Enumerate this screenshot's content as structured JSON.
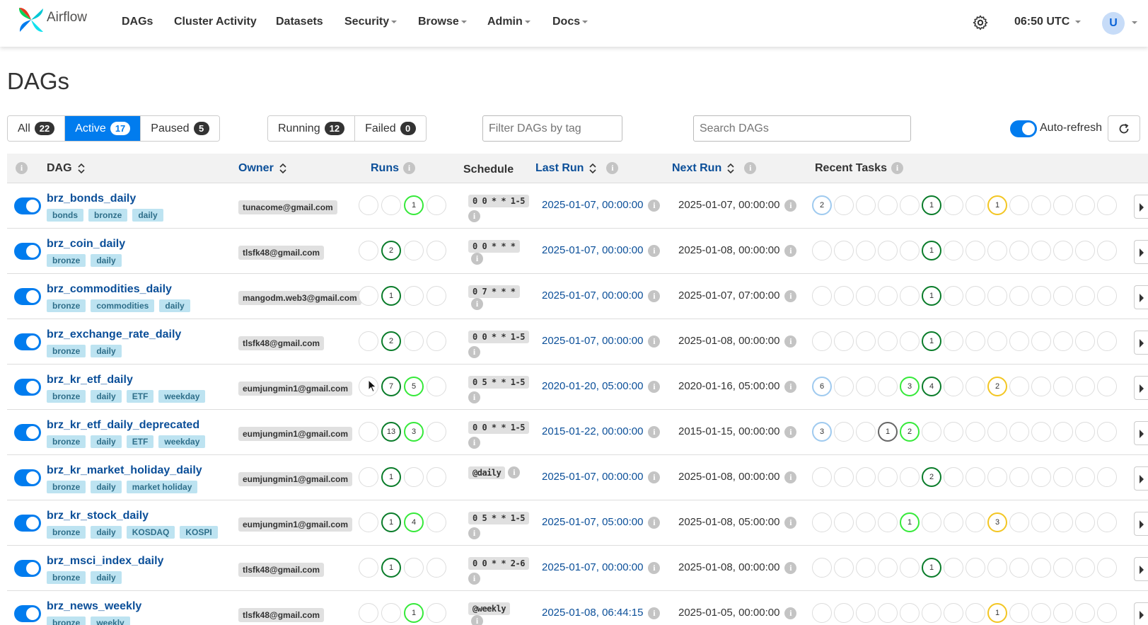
{
  "brand": {
    "name": "Airflow"
  },
  "nav": {
    "items": [
      {
        "label": "DAGs",
        "dropdown": false
      },
      {
        "label": "Cluster Activity",
        "dropdown": false
      },
      {
        "label": "Datasets",
        "dropdown": false
      },
      {
        "label": "Security",
        "dropdown": true
      },
      {
        "label": "Browse",
        "dropdown": true
      },
      {
        "label": "Admin",
        "dropdown": true
      },
      {
        "label": "Docs",
        "dropdown": true
      }
    ],
    "time": "06:50 UTC",
    "avatar_initial": "U"
  },
  "page": {
    "title": "DAGs"
  },
  "filters": {
    "status": [
      {
        "label": "All",
        "count": "22",
        "active": false
      },
      {
        "label": "Active",
        "count": "17",
        "active": true
      },
      {
        "label": "Paused",
        "count": "5",
        "active": false
      }
    ],
    "runs": [
      {
        "label": "Running",
        "count": "12"
      },
      {
        "label": "Failed",
        "count": "0"
      }
    ],
    "tag_placeholder": "Filter DAGs by tag",
    "search_placeholder": "Search DAGs",
    "autorefresh_label": "Auto-refresh"
  },
  "table": {
    "headers": {
      "dag": "DAG",
      "owner": "Owner",
      "runs": "Runs",
      "schedule": "Schedule",
      "last_run": "Last Run",
      "next_run": "Next Run",
      "recent_tasks": "Recent Tasks"
    },
    "rows": [
      {
        "name": "brz_bonds_daily",
        "tags": [
          "bonds",
          "bronze",
          "daily"
        ],
        "owner": "tunacome@gmail.com",
        "runs": [
          [
            "",
            ""
          ],
          [
            "",
            ""
          ],
          [
            "1",
            "lg"
          ],
          [
            "",
            ""
          ]
        ],
        "schedule": "0 0 * * 1-5",
        "sched_info_below": true,
        "last_run": "2025-01-07, 00:00:00",
        "next_run": "2025-01-07, 00:00:00",
        "tasks": {
          "0": [
            "2",
            "blue"
          ],
          "5": [
            "1",
            "dg"
          ],
          "8": [
            "1",
            "yel"
          ]
        }
      },
      {
        "name": "brz_coin_daily",
        "tags": [
          "bronze",
          "daily"
        ],
        "owner": "tlsfk48@gmail.com",
        "runs": [
          [
            "",
            ""
          ],
          [
            "2",
            "dg"
          ],
          [
            "",
            ""
          ],
          [
            "",
            ""
          ]
        ],
        "schedule": "0 0 * * *",
        "sched_info_below": false,
        "last_run": "2025-01-07, 00:00:00",
        "next_run": "2025-01-08, 00:00:00",
        "tasks": {
          "5": [
            "1",
            "dg"
          ]
        }
      },
      {
        "name": "brz_commodities_daily",
        "tags": [
          "bronze",
          "commodities",
          "daily"
        ],
        "owner": "mangodm.web3@gmail.com",
        "runs": [
          [
            "",
            ""
          ],
          [
            "1",
            "dg"
          ],
          [
            "",
            ""
          ],
          [
            "",
            ""
          ]
        ],
        "schedule": "0 7 * * *",
        "sched_info_below": false,
        "last_run": "2025-01-07, 00:00:00",
        "next_run": "2025-01-07, 07:00:00",
        "tasks": {
          "5": [
            "1",
            "dg"
          ]
        }
      },
      {
        "name": "brz_exchange_rate_daily",
        "tags": [
          "bronze",
          "daily"
        ],
        "owner": "tlsfk48@gmail.com",
        "runs": [
          [
            "",
            ""
          ],
          [
            "2",
            "dg"
          ],
          [
            "",
            ""
          ],
          [
            "",
            ""
          ]
        ],
        "schedule": "0 0 * * 1-5",
        "sched_info_below": true,
        "last_run": "2025-01-07, 00:00:00",
        "next_run": "2025-01-08, 00:00:00",
        "tasks": {
          "5": [
            "1",
            "dg"
          ]
        }
      },
      {
        "name": "brz_kr_etf_daily",
        "tags": [
          "bronze",
          "daily",
          "ETF",
          "weekday"
        ],
        "owner": "eumjungmin1@gmail.com",
        "runs": [
          [
            "",
            ""
          ],
          [
            "7",
            "dg"
          ],
          [
            "5",
            "lg"
          ],
          [
            "",
            ""
          ]
        ],
        "schedule": "0 5 * * 1-5",
        "sched_info_below": true,
        "last_run": "2020-01-20, 05:00:00",
        "next_run": "2020-01-16, 05:00:00",
        "tasks": {
          "0": [
            "6",
            "blue"
          ],
          "4": [
            "3",
            "lg"
          ],
          "5": [
            "4",
            "dg"
          ],
          "8": [
            "2",
            "yel"
          ]
        }
      },
      {
        "name": "brz_kr_etf_daily_deprecated",
        "tags": [
          "bronze",
          "daily",
          "ETF",
          "weekday"
        ],
        "owner": "eumjungmin1@gmail.com",
        "runs": [
          [
            "",
            ""
          ],
          [
            "13",
            "dg"
          ],
          [
            "3",
            "lg"
          ],
          [
            "",
            ""
          ]
        ],
        "schedule": "0 0 * * 1-5",
        "sched_info_below": true,
        "last_run": "2015-01-22, 00:00:00",
        "next_run": "2015-01-15, 00:00:00",
        "tasks": {
          "0": [
            "3",
            "blue"
          ],
          "3": [
            "1",
            "gray"
          ],
          "4": [
            "2",
            "lg"
          ]
        }
      },
      {
        "name": "brz_kr_market_holiday_daily",
        "tags": [
          "bronze",
          "daily",
          "market holiday"
        ],
        "owner": "eumjungmin1@gmail.com",
        "runs": [
          [
            "",
            ""
          ],
          [
            "1",
            "dg"
          ],
          [
            "",
            ""
          ],
          [
            "",
            ""
          ]
        ],
        "schedule": "@daily",
        "sched_info_below": false,
        "last_run": "2025-01-07, 00:00:00",
        "next_run": "2025-01-08, 00:00:00",
        "tasks": {
          "5": [
            "2",
            "dg"
          ]
        }
      },
      {
        "name": "brz_kr_stock_daily",
        "tags": [
          "bronze",
          "daily",
          "KOSDAQ",
          "KOSPI"
        ],
        "owner": "eumjungmin1@gmail.com",
        "runs": [
          [
            "",
            ""
          ],
          [
            "1",
            "dg"
          ],
          [
            "4",
            "lg"
          ],
          [
            "",
            ""
          ]
        ],
        "schedule": "0 5 * * 1-5",
        "sched_info_below": true,
        "last_run": "2025-01-07, 05:00:00",
        "next_run": "2025-01-08, 05:00:00",
        "tasks": {
          "4": [
            "1",
            "lg"
          ],
          "8": [
            "3",
            "yel"
          ]
        }
      },
      {
        "name": "brz_msci_index_daily",
        "tags": [
          "bronze",
          "daily"
        ],
        "owner": "tlsfk48@gmail.com",
        "runs": [
          [
            "",
            ""
          ],
          [
            "1",
            "dg"
          ],
          [
            "",
            ""
          ],
          [
            "",
            ""
          ]
        ],
        "schedule": "0 0 * * 2-6",
        "sched_info_below": true,
        "last_run": "2025-01-07, 00:00:00",
        "next_run": "2025-01-08, 00:00:00",
        "tasks": {
          "5": [
            "1",
            "dg"
          ]
        }
      },
      {
        "name": "brz_news_weekly",
        "tags": [
          "bronze",
          "weekly"
        ],
        "owner": "tlsfk48@gmail.com",
        "runs": [
          [
            "",
            ""
          ],
          [
            "",
            ""
          ],
          [
            "1",
            "lg"
          ],
          [
            "",
            ""
          ]
        ],
        "schedule": "@weekly",
        "sched_info_below": false,
        "last_run": "2025-01-08, 06:44:15",
        "next_run": "2025-01-05, 00:00:00",
        "tasks": {
          "8": [
            "1",
            "yel"
          ]
        }
      }
    ],
    "task_slots": 14
  },
  "colors": {
    "accent": "#017cee",
    "link": "#0b4f99",
    "tag_bg": "#bde3f1",
    "success_dark": "#0a7c2a",
    "running": "#36e93a",
    "queued": "#f3c623",
    "scheduled": "#9fcaef"
  },
  "icons": {
    "settings": "gear-icon",
    "refresh": "refresh-icon",
    "sort": "sort-icon",
    "info": "info-icon"
  }
}
